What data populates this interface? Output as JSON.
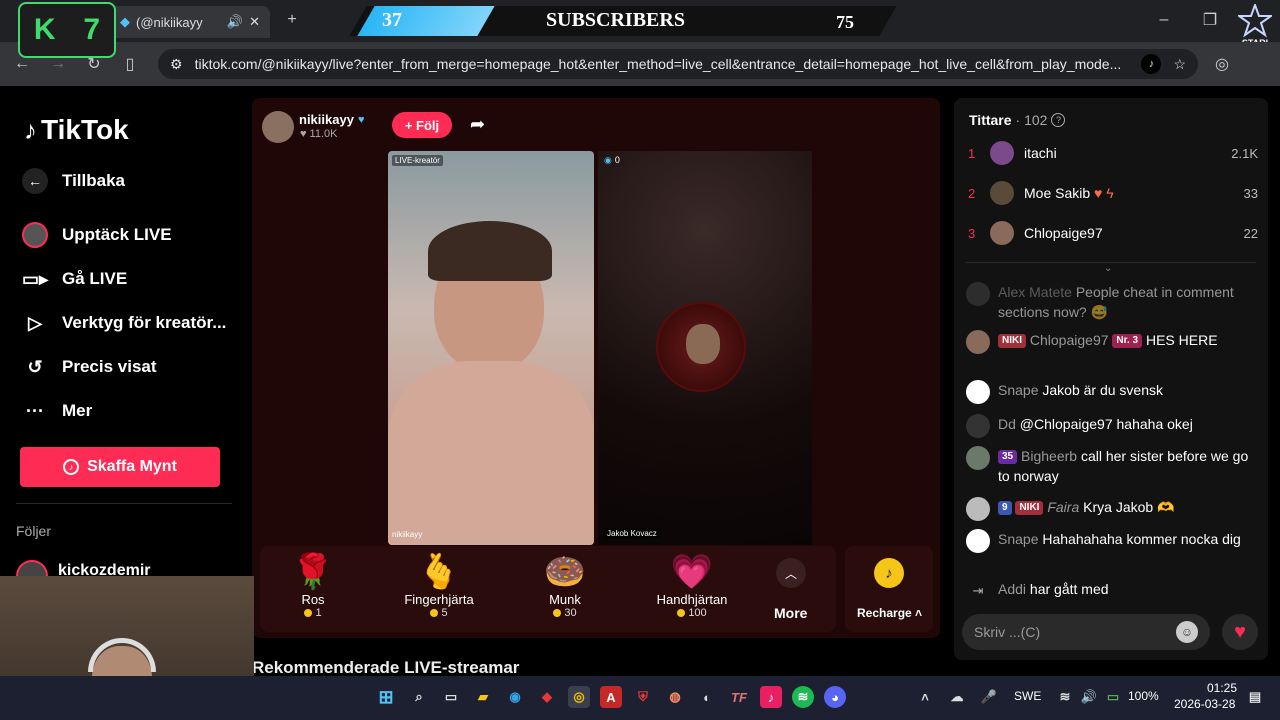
{
  "browser": {
    "tab_title": "(@nikiikayy",
    "url": "tiktok.com/@nikiikayy/live?enter_from_merge=homepage_hot&enter_method=live_cell&entrance_detail=homepage_hot_live_cell&from_play_mode...",
    "new_tab": "+",
    "win_min": "–",
    "win_max": "❐",
    "win_close": "✕"
  },
  "overlay": {
    "k_letter": "K",
    "k_number": "7",
    "subs_count": "37",
    "subs_label": "SUBSCRIBERS",
    "subs_goal": "75",
    "stari_label": "STARI"
  },
  "sidebar": {
    "logo": "TikTok",
    "back": "Tillbaka",
    "items": [
      {
        "label": "Upptäck LIVE",
        "icon": "avatar-icon"
      },
      {
        "label": "Gå LIVE",
        "icon": "camera-icon"
      },
      {
        "label": "Verktyg för kreatör...",
        "icon": "creator-tools-icon"
      },
      {
        "label": "Precis visat",
        "icon": "history-icon"
      },
      {
        "label": "Mer",
        "icon": "more-icon"
      }
    ],
    "coins_button": "Skaffa Mynt",
    "following_label": "Följer",
    "following_user": "kickozdemir"
  },
  "stream": {
    "host_name": "nikiikayy",
    "host_likes": "11.0K",
    "follow_button": "+ Följ",
    "creator_tag": "LIVE-kreatör",
    "guest_count": "0",
    "host_label": "nikiikayy",
    "guest_name": "Jakob Kovacz",
    "recommended": "Rekommenderade LIVE-streamar"
  },
  "gifts": [
    {
      "name": "Ros",
      "price": "1",
      "glyph": "🌹"
    },
    {
      "name": "Fingerhjärta",
      "price": "5",
      "glyph": "🫰"
    },
    {
      "name": "Munk",
      "price": "30",
      "glyph": "🍩"
    },
    {
      "name": "Handhjärtan",
      "price": "100",
      "glyph": "💗"
    }
  ],
  "gift_more": "More",
  "gift_recharge": "Recharge",
  "viewers": {
    "title": "Tittare",
    "count": "· 102",
    "ranks": [
      {
        "n": "1",
        "name": "itachi",
        "value": "2.1K",
        "color": "#7a4a8a"
      },
      {
        "n": "2",
        "name": "Moe Sakib",
        "value": "33",
        "color": "#5a4a3a"
      },
      {
        "n": "3",
        "name": "Chlopaige97",
        "value": "22",
        "color": "#8a6a5a"
      }
    ]
  },
  "chat": [
    {
      "user": "Alex Matete",
      "text": "People cheat in comment sections now? 😅"
    },
    {
      "badge1": "NIKI",
      "user": "Chlopaige97",
      "badge2": "Nr. 3",
      "text": "HES HERE"
    },
    {
      "user": "Snape",
      "text": "Jakob är du svensk"
    },
    {
      "user": "Dd",
      "text": "@Chlopaige97 hahaha okej"
    },
    {
      "badge1": "35",
      "user": "Bigheerb",
      "text": "call her sister before we go to norway"
    },
    {
      "badge1": "9",
      "badge2": "NIKI",
      "user": "Faira",
      "text": "Krya Jakob 🫶"
    },
    {
      "user": "Snape",
      "text": "Hahahahaha kommer nocka dig"
    },
    {
      "user": "Addi",
      "text": "har gått med"
    }
  ],
  "chat_placeholder": "Skriv ...(C)",
  "taskbar": {
    "lang": "SWE",
    "battery": "100%",
    "time": "01:25",
    "date": "2026-03-28"
  }
}
